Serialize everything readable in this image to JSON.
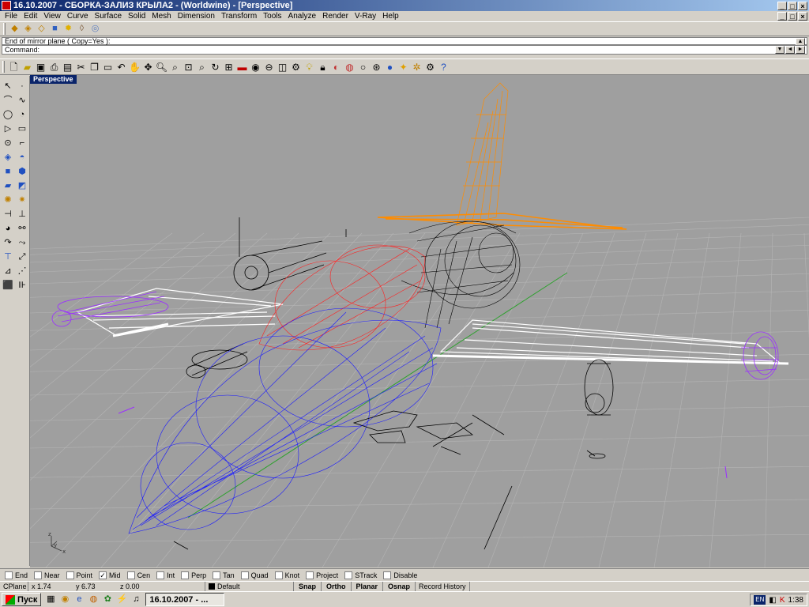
{
  "window": {
    "title": "16.10.2007 - СБОРКА-ЗАЛИЗ КРЫЛА2 -  (Worldwine) - [Perspective]",
    "buttons": [
      "_",
      "□",
      "×"
    ]
  },
  "menu": {
    "items": [
      "File",
      "Edit",
      "View",
      "Curve",
      "Surface",
      "Solid",
      "Mesh",
      "Dimension",
      "Transform",
      "Tools",
      "Analyze",
      "Render",
      "V-Ray",
      "Help"
    ]
  },
  "command": {
    "history": "End of mirror plane ( Copy=Yes ):",
    "prompt": "Command:",
    "value": ""
  },
  "viewport": {
    "label": "Perspective",
    "axes": {
      "z": "z",
      "y": "y",
      "x": "x"
    },
    "colors": {
      "background": "#9f9f9f",
      "grid": "#b5b5b5",
      "nose": "#1a1aff",
      "canopy": "#ff2020",
      "rear": "#000000",
      "tail": "#ff8c00",
      "wing": "#ffffff",
      "tips": "#9b30ff",
      "yaxis": "#2fa02f"
    }
  },
  "osnaps": [
    {
      "label": "End",
      "checked": false
    },
    {
      "label": "Near",
      "checked": false
    },
    {
      "label": "Point",
      "checked": false
    },
    {
      "label": "Mid",
      "checked": true
    },
    {
      "label": "Cen",
      "checked": false
    },
    {
      "label": "Int",
      "checked": false
    },
    {
      "label": "Perp",
      "checked": false
    },
    {
      "label": "Tan",
      "checked": false
    },
    {
      "label": "Quad",
      "checked": false
    },
    {
      "label": "Knot",
      "checked": false
    },
    {
      "label": "Project",
      "checked": false
    },
    {
      "label": "STrack",
      "checked": false
    },
    {
      "label": "Disable",
      "checked": false
    }
  ],
  "status": {
    "cplane": "CPlane",
    "x": "x 1.74",
    "y": "y 6.73",
    "z": "z 0.00",
    "layer": "Default",
    "toggles": [
      "Snap",
      "Ortho",
      "Planar",
      "Osnap"
    ],
    "record": "Record History"
  },
  "taskbar": {
    "start": "Пуск",
    "task": "16.10.2007 - ...",
    "lang": "EN",
    "clock": "1:38"
  }
}
